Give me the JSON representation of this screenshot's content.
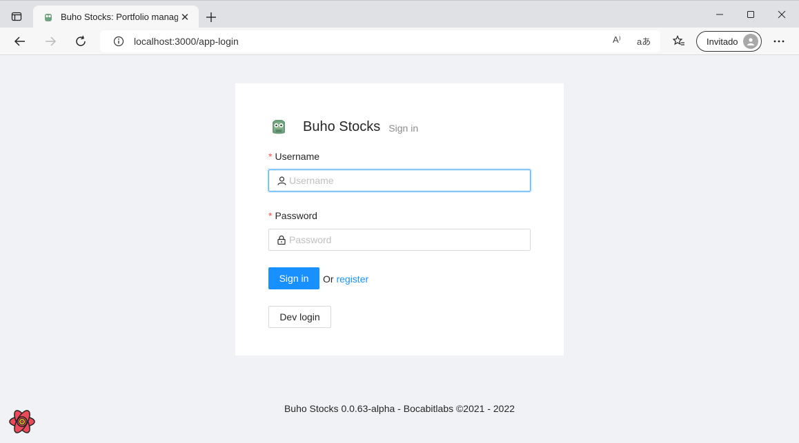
{
  "browser": {
    "tab_title": "Buho Stocks: Portfolio manager",
    "url": "localhost:3000/app-login",
    "profile_label": "Invitado",
    "read_aloud_label": "A⁾",
    "translate_label": "aあ"
  },
  "icons": {
    "tab_actions": "tab-actions-icon",
    "close": "close-icon",
    "new_tab": "plus-icon",
    "back": "back-arrow-icon",
    "forward": "forward-arrow-icon",
    "refresh": "refresh-icon",
    "info": "info-icon",
    "favorites": "favorites-icon",
    "more": "more-icon",
    "owl": "owl-logo-icon",
    "user": "user-icon",
    "lock": "lock-icon",
    "react": "react-devtools-icon"
  },
  "colors": {
    "primary": "#1890ff",
    "required": "#ff4d4f",
    "page_bg": "#f0f2f5"
  },
  "login": {
    "brand_title": "Buho Stocks",
    "brand_subtitle": "Sign in",
    "username_label": "Username",
    "username_placeholder": "Username",
    "password_label": "Password",
    "password_placeholder": "Password",
    "required_mark": "*",
    "sign_in_button": "Sign in",
    "or_text": "Or",
    "register_link": "register",
    "dev_login_button": "Dev login"
  },
  "footer": {
    "text": "Buho Stocks 0.0.63-alpha - Bocabitlabs ©2021 - 2022"
  }
}
